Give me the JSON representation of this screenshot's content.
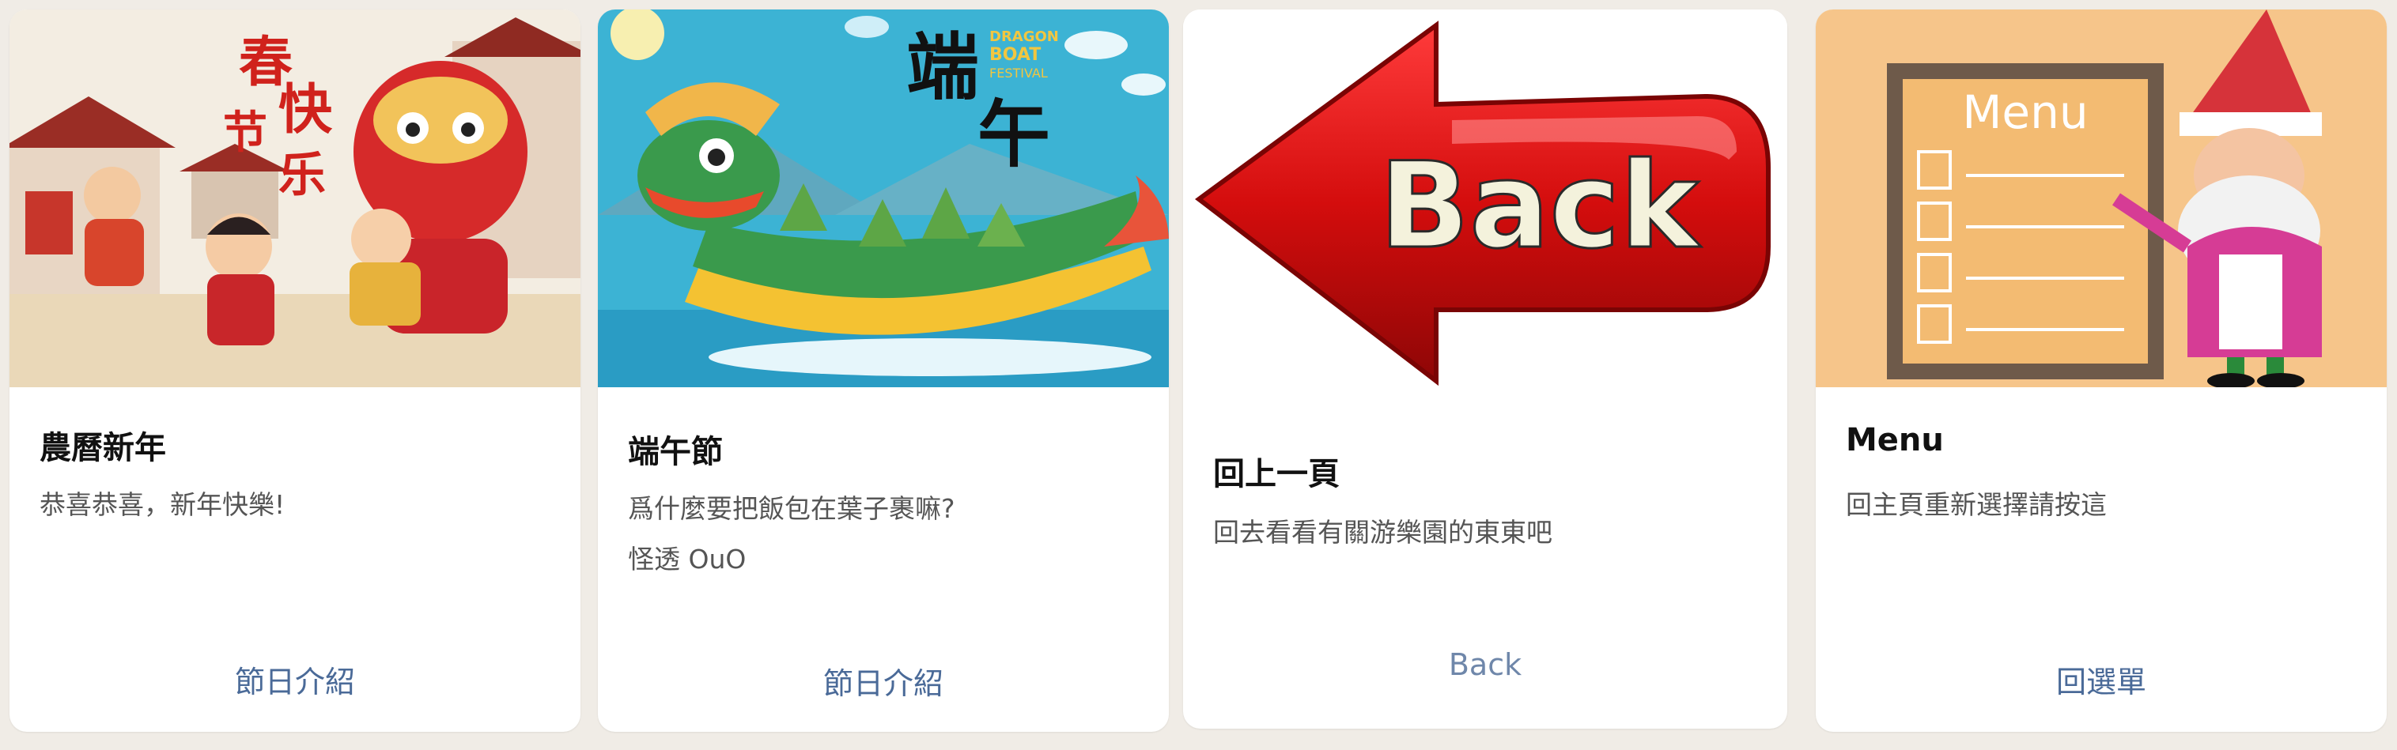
{
  "cards": [
    {
      "title": "農曆新年",
      "description": "恭喜恭喜，新年快樂!",
      "action_label": "節日介紹",
      "image": {
        "kind": "illustration",
        "calligraphy": [
          "春",
          "快",
          "节",
          "乐"
        ]
      }
    },
    {
      "title": "端午節",
      "description": "爲什麼要把飯包在葉子裹嘛?\n怪透 OuO",
      "action_label": "節日介紹",
      "image": {
        "kind": "illustration",
        "big_chars": [
          "端",
          "午"
        ],
        "banner": [
          "DRAGON",
          "BOAT",
          "FESTIVAL"
        ]
      }
    },
    {
      "title": "回上一頁",
      "description": "回去看看有關游樂園的東東吧",
      "action_label": "Back",
      "image": {
        "kind": "arrow-sign",
        "sign_text": "Back"
      }
    },
    {
      "title": "Menu",
      "description": "回主頁重新選擇請按這",
      "action_label": "回選單",
      "image": {
        "kind": "illustration",
        "board_text": "Menu"
      }
    }
  ],
  "colors": {
    "page_bg": "#f0ece6",
    "card_bg": "#ffffff",
    "action_text": "#4a6a98",
    "title_text": "#111111",
    "desc_text": "#555555"
  }
}
